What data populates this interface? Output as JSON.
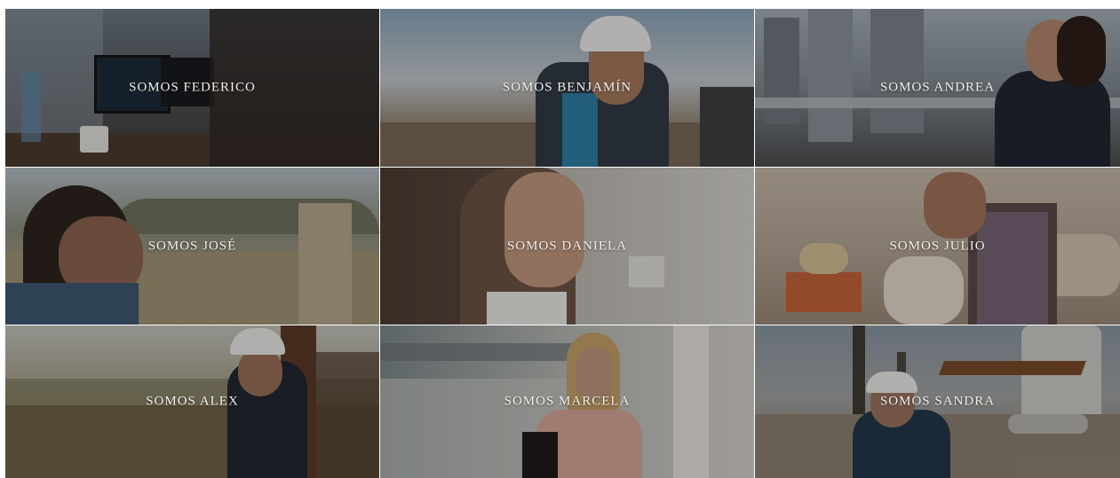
{
  "tiles": [
    {
      "id": "federico",
      "label": "SOMOS FEDERICO"
    },
    {
      "id": "benjamin",
      "label": "SOMOS BENJAMÍN"
    },
    {
      "id": "andrea",
      "label": "SOMOS ANDREA"
    },
    {
      "id": "jose",
      "label": "SOMOS JOSÉ"
    },
    {
      "id": "daniela",
      "label": "SOMOS DANIELA"
    },
    {
      "id": "julio",
      "label": "SOMOS JULIO"
    },
    {
      "id": "alex",
      "label": "SOMOS ALEX"
    },
    {
      "id": "marcela",
      "label": "SOMOS MARCELA"
    },
    {
      "id": "sandra",
      "label": "SOMOS SANDRA"
    }
  ]
}
